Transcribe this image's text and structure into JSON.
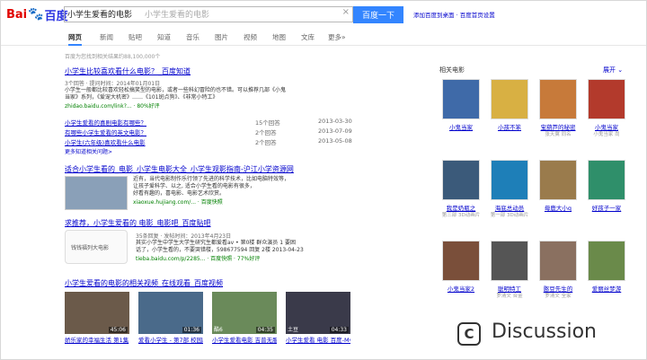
{
  "header": {
    "logo_bai": "Bai",
    "logo_du": "百度",
    "query": "小学生爱看的电影",
    "query_ghost": "小学生爱看的电影",
    "search_button": "百度一下",
    "top_links": "添加百度到桌面 · 百度首页设置"
  },
  "tabs": [
    "网页",
    "新闻",
    "贴吧",
    "知道",
    "音乐",
    "图片",
    "视频",
    "地图",
    "文库",
    "更多»"
  ],
  "result_count": "百度为您找到相关结果约88,100,000个",
  "r1": {
    "title": "小学生比较喜欢看什么电影？_百度知道",
    "meta": "3个回答 · 提问时间：2014年01月01日",
    "snip1": "小学生一般都比较喜欢轻松搞笑型的电影，或者一些科幻冒险的也不错。可以推荐几部《小鬼",
    "snip2": "当家》系列，《爱宠大机密》……《101斑点狗》、《非常小特工》",
    "url": "zhidao.baidu.com/link?... · 80%好评",
    "qa": [
      {
        "q": "小学生爱看的喜剧电影有哪些？",
        "n": "15个回答",
        "d": "2013-03-30"
      },
      {
        "q": "有哪些小学生爱看的英文电影？",
        "n": "2个回答",
        "d": "2013-07-09"
      },
      {
        "q": "小学生(六年级)喜欢看什么电影",
        "n": "2个回答",
        "d": "2013-05-08"
      }
    ],
    "more": "更多知道相关问题>"
  },
  "r2": {
    "title": "适合小学生看的_电影_小学生电影大全_小学生观影指南-沪江小学资源网",
    "snip1": "近有，当代电影制作乐行领了先进的科学技术，比如电脑特效等，",
    "snip2": "让孩子爱科学、以之, 适合小学生看的电影有很多，",
    "snip3": "好看有趣的，喜电影、电影艺术欣赏。",
    "url": "xiaoxue.hujiang.com/... · 百度快照"
  },
  "r3": {
    "title": "求推荐，小学生爱看的 电影_电影吧_百度贴吧",
    "meta": "35条回复 · 发帖时间：2013年4月23日",
    "snip1": "其实小学生中学生大学生研究生都爱看av • 第0楼 群众演员 1 要困",
    "snip2": "话了，小学生看的，不要哭错楼，598677594 回复 2楼 2013-04-23",
    "url": "tieba.baidu.com/p/2285... · 百度快照 · 77%好评",
    "thumb_text": "钱钱福列大电影"
  },
  "r4": {
    "title": "小学生爱看的电影的相关视频_在线观看_百度视频",
    "videos": [
      {
        "dur": "45:06",
        "chn": "",
        "cap": "娇乐家的幸福生活 第1集"
      },
      {
        "dur": "01:36",
        "chn": "",
        "cap": "爱看小学生 - 第7部 校园剧集"
      },
      {
        "dur": "04:35",
        "chn": "酷6",
        "cap": "小学生爱看电影 吉普无服"
      },
      {
        "dur": "04:33",
        "chn": "土豆",
        "cap": "小学生爱看 电影 百度-My..."
      }
    ]
  },
  "side": {
    "header": "相关电影",
    "expand": "展开",
    "posters": [
      {
        "cap": "小鬼当家",
        "sub": "",
        "color": "#3f6aa8"
      },
      {
        "cap": "小孩不笨",
        "sub": "",
        "color": "#d8b043"
      },
      {
        "cap": "宝葫芦的秘密",
        "sub": "张天翼 同名",
        "color": "#c77a3a"
      },
      {
        "cap": "小鬼当家",
        "sub": "小鬼当家 尚",
        "color": "#b33a2c"
      },
      {
        "cap": "我是奶瓶之",
        "sub": "第三部 3D动画片",
        "color": "#3b5a7a"
      },
      {
        "cap": "海底总动员",
        "sub": "第一部 3D动画片",
        "color": "#1e7fb8"
      },
      {
        "cap": "母鹿大小q",
        "sub": "",
        "color": "#9a7b4c"
      },
      {
        "cap": "好孩子一家",
        "sub": "",
        "color": "#2f8f6a"
      },
      {
        "cap": "小鬼当家2",
        "sub": "",
        "color": "#7a4f3a"
      },
      {
        "cap": "聪明特工",
        "sub": "罗清文 合金",
        "color": "#555555"
      },
      {
        "cap": "憨豆先生的",
        "sub": "罗清文 全家",
        "color": "#8a7060"
      },
      {
        "cap": "爱丽丝梦游",
        "sub": "",
        "color": "#6a8a4a"
      }
    ]
  },
  "discussion": "Discussion"
}
